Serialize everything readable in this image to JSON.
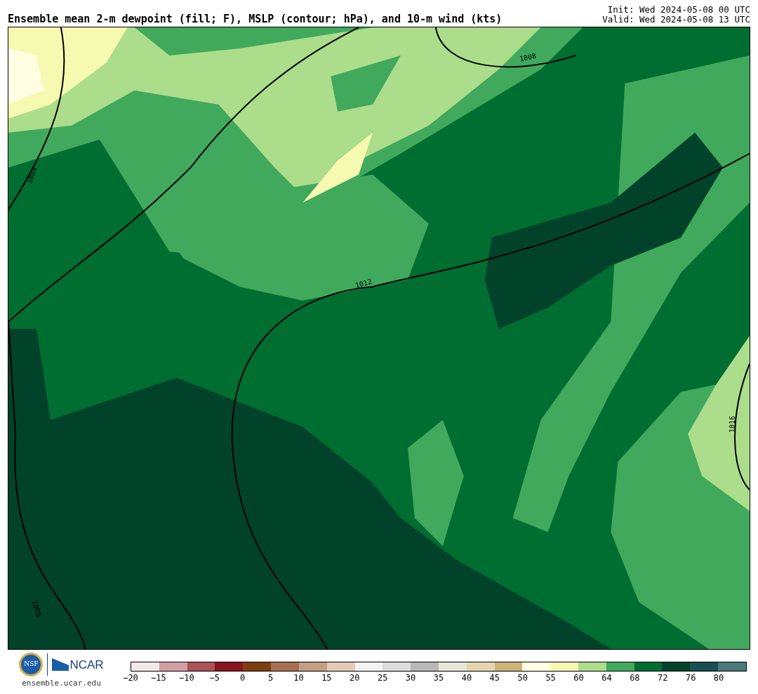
{
  "title": "Ensemble mean 2-m dewpoint (fill; F), MSLP (contour; hPa), and 10-m wind (kts)",
  "init": "Init: Wed 2024-05-08 00 UTC",
  "valid": "Valid: Wed 2024-05-08 13 UTC",
  "contour_labels": [
    "1004",
    "1008",
    "1012",
    "1016",
    "1008"
  ],
  "logos": {
    "nsf": "NSF",
    "ncar": "NCAR",
    "site": "ensemble.ucar.edu"
  },
  "colorbar": {
    "segments": [
      {
        "color": "#f4e9e9"
      },
      {
        "color": "#d2a0a4"
      },
      {
        "color": "#ab5358"
      },
      {
        "color": "#8a1421"
      },
      {
        "color": "#7e3f10"
      },
      {
        "color": "#a87050"
      },
      {
        "color": "#c59f84"
      },
      {
        "color": "#e4c9b9"
      },
      {
        "color": "#f3f3f3"
      },
      {
        "color": "#dcdcdc"
      },
      {
        "color": "#b8b8b8"
      },
      {
        "color": "#e6e6d6"
      },
      {
        "color": "#e5d6b0"
      },
      {
        "color": "#ccb478"
      },
      {
        "color": "#fffde2"
      },
      {
        "color": "#f6fab0"
      },
      {
        "color": "#abdd8b"
      },
      {
        "color": "#41a95c"
      },
      {
        "color": "#006d31"
      },
      {
        "color": "#00432a"
      },
      {
        "color": "#194f52"
      },
      {
        "color": "#4a7a7a"
      }
    ],
    "ticks": [
      "−20",
      "−15",
      "−10",
      "−5",
      "0",
      "5",
      "10",
      "15",
      "20",
      "25",
      "30",
      "35",
      "40",
      "45",
      "50",
      "55",
      "60",
      "64",
      "68",
      "72",
      "76",
      "80"
    ]
  }
}
